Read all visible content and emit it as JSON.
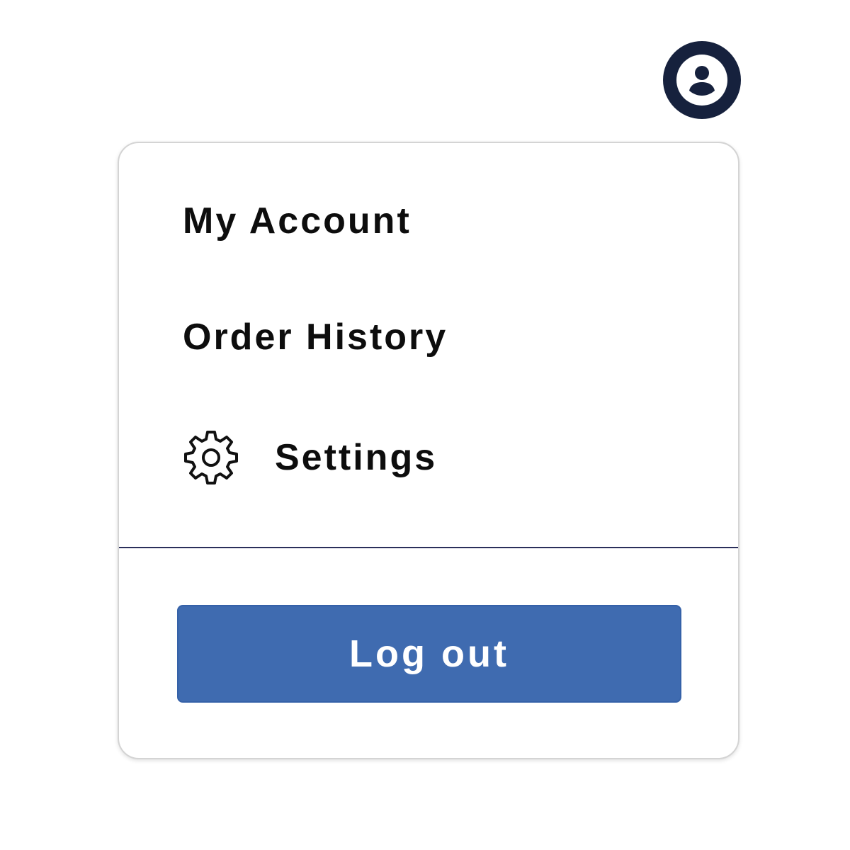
{
  "header": {
    "avatar_icon": "user-avatar-icon",
    "avatar_bg_color": "#16213d"
  },
  "menu": {
    "items": [
      {
        "label": "My Account"
      },
      {
        "label": "Order History"
      },
      {
        "label": "Settings",
        "icon": "gear-icon"
      }
    ],
    "logout_label": "Log out",
    "logout_color": "#3f6bb0"
  }
}
